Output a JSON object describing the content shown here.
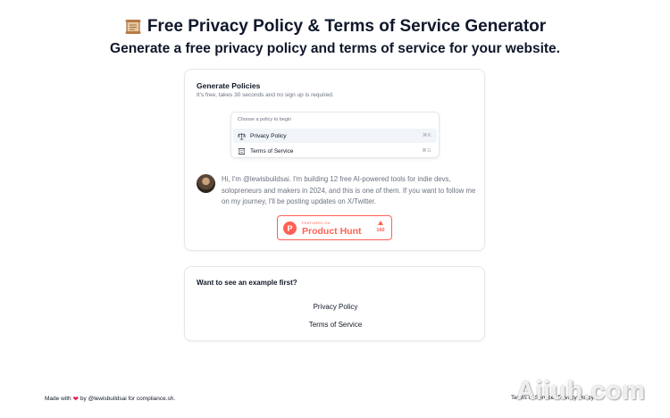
{
  "header": {
    "title": "Free Privacy Policy & Terms of Service Generator",
    "subtitle": "Generate a free privacy policy and terms of service for your website."
  },
  "generate_card": {
    "title": "Generate Policies",
    "description": "It's free, takes 30 seconds and no sign up is required.",
    "command": {
      "heading": "Choose a policy to begin",
      "items": [
        {
          "label": "Privacy Policy",
          "icon": "scale-icon",
          "shortcut": "⌘K"
        },
        {
          "label": "Terms of Service",
          "icon": "scroll-icon",
          "shortcut": "⌘G"
        }
      ]
    },
    "intro": "Hi, I'm @lewisbuildsai. I'm building 12 free AI-powered tools for indie devs, solopreneurs and makers in 2024, and this is one of them. If you want to follow me on my journey, I'll be posting updates on X/Twitter.",
    "product_hunt": {
      "featured": "FEATURED ON",
      "name": "Product Hunt",
      "votes": "160",
      "color": "#ff6154"
    }
  },
  "example_card": {
    "title": "Want to see an example first?",
    "links": [
      "Privacy Policy",
      "Terms of Service"
    ]
  },
  "footer": {
    "made_with": "Made with",
    "by_text": "by @lewisbuildsai for compliance.sh.",
    "links": [
      "Terms of Service",
      "Privacy Policy"
    ]
  },
  "watermark": "Aiiuh.com"
}
